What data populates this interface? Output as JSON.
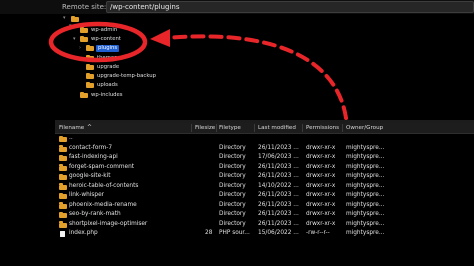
{
  "remote": {
    "label": "Remote site:",
    "path": "/wp-content/plugins"
  },
  "tree": {
    "items": [
      {
        "label": "?"
      },
      {
        "label": "wp-admin"
      },
      {
        "label": "wp-content"
      },
      {
        "label": "plugins"
      },
      {
        "label": "themes"
      },
      {
        "label": "upgrade"
      },
      {
        "label": "upgrade-temp-backup"
      },
      {
        "label": "uploads"
      },
      {
        "label": "wp-includes"
      }
    ]
  },
  "table": {
    "headers": [
      "Filename",
      "Filesize",
      "Filetype",
      "Last modified",
      "Permissions",
      "Owner/Group"
    ],
    "sort_indicator": "^",
    "rows": [
      {
        "name": "..",
        "size": "",
        "type": "",
        "modified": "",
        "perms": "",
        "owner": ""
      },
      {
        "name": "contact-form-7",
        "size": "",
        "type": "Directory",
        "modified": "26/11/2023 ...",
        "perms": "drwxr-xr-x",
        "owner": "mightyspre..."
      },
      {
        "name": "fast-indexing-api",
        "size": "",
        "type": "Directory",
        "modified": "17/06/2023 ...",
        "perms": "drwxr-xr-x",
        "owner": "mightyspre..."
      },
      {
        "name": "forget-spam-comment",
        "size": "",
        "type": "Directory",
        "modified": "26/11/2023 ...",
        "perms": "drwxr-xr-x",
        "owner": "mightyspre..."
      },
      {
        "name": "google-site-kit",
        "size": "",
        "type": "Directory",
        "modified": "26/11/2023 ...",
        "perms": "drwxr-xr-x",
        "owner": "mightyspre..."
      },
      {
        "name": "heroic-table-of-contents",
        "size": "",
        "type": "Directory",
        "modified": "14/10/2022 ...",
        "perms": "drwxr-xr-x",
        "owner": "mightyspre..."
      },
      {
        "name": "link-whisper",
        "size": "",
        "type": "Directory",
        "modified": "26/11/2023 ...",
        "perms": "drwxr-xr-x",
        "owner": "mightyspre..."
      },
      {
        "name": "phoenix-media-rename",
        "size": "",
        "type": "Directory",
        "modified": "26/11/2023 ...",
        "perms": "drwxr-xr-x",
        "owner": "mightyspre..."
      },
      {
        "name": "seo-by-rank-math",
        "size": "",
        "type": "Directory",
        "modified": "26/11/2023 ...",
        "perms": "drwxr-xr-x",
        "owner": "mightyspre..."
      },
      {
        "name": "shortpixel-image-optimiser",
        "size": "",
        "type": "Directory",
        "modified": "26/11/2023 ...",
        "perms": "drwxr-xr-x",
        "owner": "mightyspre..."
      },
      {
        "name": "index.php",
        "size": "28",
        "type": "PHP sour...",
        "modified": "15/06/2022 ...",
        "perms": "-rw-r--r--",
        "owner": "mightyspre..."
      }
    ]
  },
  "colors": {
    "folder": "#e2a02b",
    "selection": "#1f5fd1",
    "annotation": "#e8262a"
  }
}
